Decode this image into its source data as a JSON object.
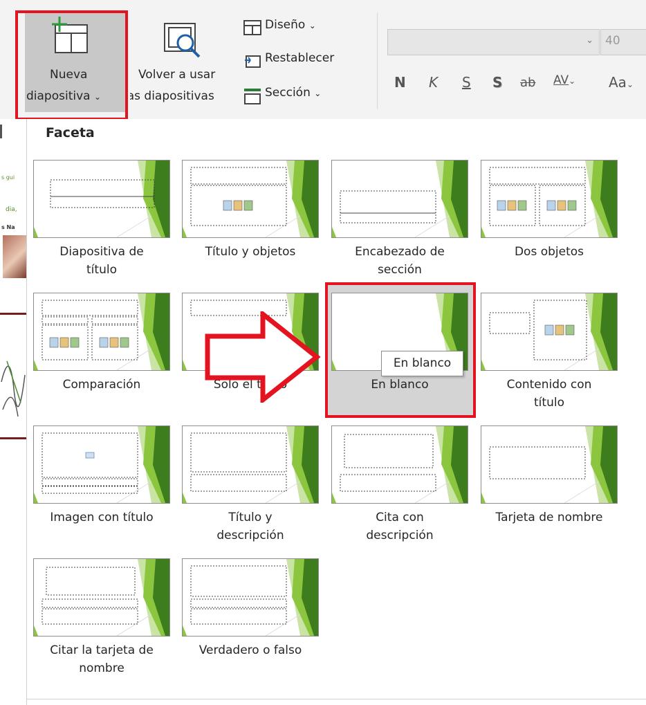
{
  "ribbon": {
    "new_slide_line1": "Nueva",
    "new_slide_line2": "diapositiva",
    "reuse_line1": "Volver a usar",
    "reuse_line2": "las diapositivas",
    "design": "Diseño",
    "reset": "Restablecer",
    "section": "Sección",
    "font_size": "40",
    "format_buttons": [
      "N",
      "K",
      "S",
      "S",
      "ab",
      "AV",
      "Aa"
    ]
  },
  "doc_fragments": [
    "s gui",
    "dia,",
    "s Na"
  ],
  "gallery": {
    "title": "Faceta",
    "layouts": [
      {
        "line1": "Diapositiva de",
        "line2": "título"
      },
      {
        "line1": "Título y objetos",
        "line2": ""
      },
      {
        "line1": "Encabezado de",
        "line2": "sección"
      },
      {
        "line1": "Dos objetos",
        "line2": ""
      },
      {
        "line1": "Comparación",
        "line2": ""
      },
      {
        "line1": "Solo el título",
        "line2": ""
      },
      {
        "line1": "En blanco",
        "line2": ""
      },
      {
        "line1": "Contenido con",
        "line2": "título"
      },
      {
        "line1": "Imagen con título",
        "line2": ""
      },
      {
        "line1": "Título y",
        "line2": "descripción"
      },
      {
        "line1": "Cita con",
        "line2": "descripción"
      },
      {
        "line1": "Tarjeta de nombre",
        "line2": ""
      },
      {
        "line1": "Citar la tarjeta de",
        "line2": "nombre"
      },
      {
        "line1": "Verdadero o falso",
        "line2": ""
      }
    ],
    "tooltip": "En blanco"
  },
  "colors": {
    "highlight_red": "#e3141f",
    "accent_green": "#8cc63f",
    "dark_green": "#3d7d1e"
  }
}
